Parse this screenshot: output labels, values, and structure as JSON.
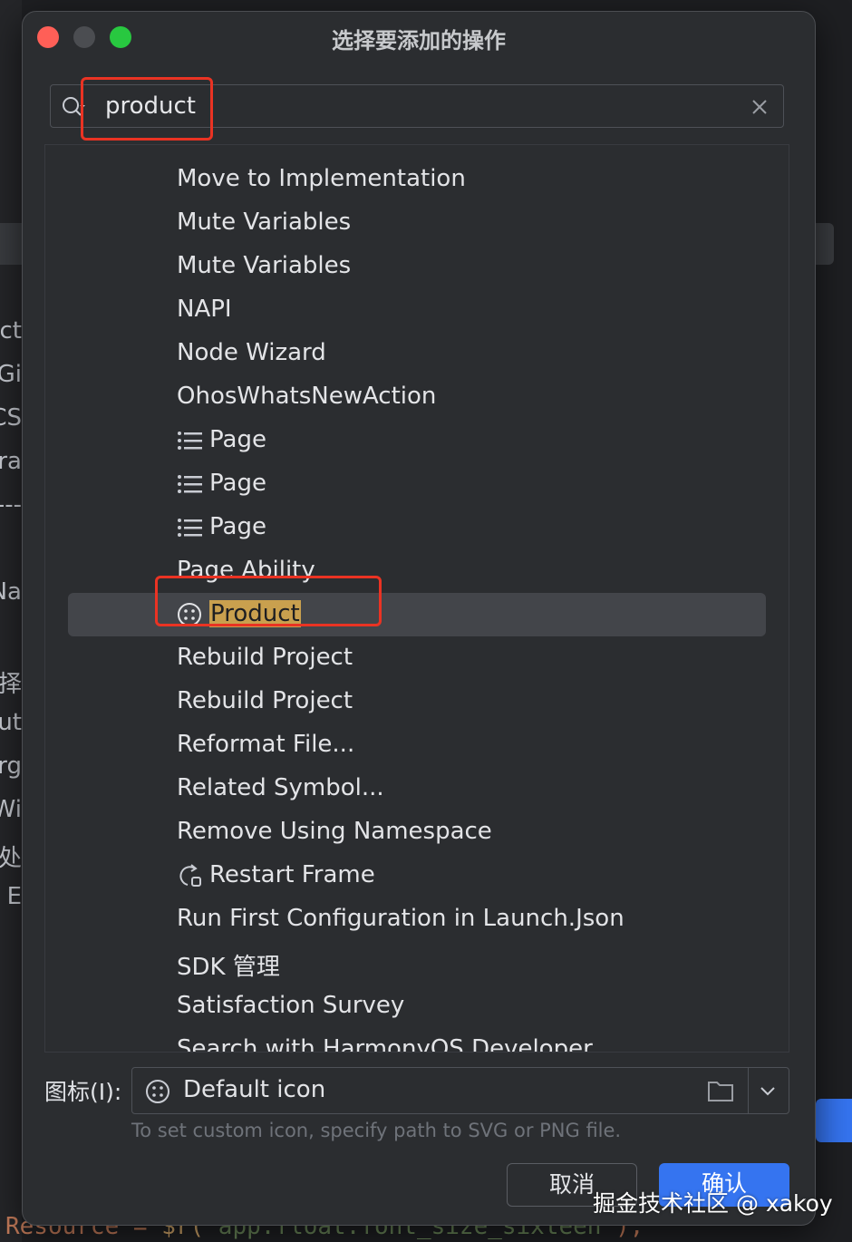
{
  "background": {
    "fragments": [
      "ect",
      "Gi",
      "CS",
      "era",
      "---",
      "Na",
      "择",
      "ut",
      "arg",
      "Wi",
      "处",
      "E"
    ],
    "code_prefix": "Resource = ",
    "code_fn": "$r(",
    "code_string": "'app.float.font_size_sixteen'",
    "code_suffix": ");"
  },
  "dialog": {
    "title": "选择要添加的操作",
    "search": {
      "value": "product"
    },
    "items": [
      {
        "label": "Move to Implementation",
        "icon": ""
      },
      {
        "label": "Mute Variables",
        "icon": ""
      },
      {
        "label": "Mute Variables",
        "icon": ""
      },
      {
        "label": "NAPI",
        "icon": ""
      },
      {
        "label": "Node Wizard",
        "icon": ""
      },
      {
        "label": "OhosWhatsNewAction",
        "icon": ""
      },
      {
        "label": "Page",
        "icon": "list-icon"
      },
      {
        "label": "Page",
        "icon": "list-icon"
      },
      {
        "label": "Page",
        "icon": "list-icon"
      },
      {
        "label": "Page Ability",
        "icon": ""
      },
      {
        "label": "Product",
        "icon": "face-icon",
        "selected": true
      },
      {
        "label": "Rebuild Project",
        "icon": ""
      },
      {
        "label": "Rebuild Project",
        "icon": ""
      },
      {
        "label": "Reformat File...",
        "icon": ""
      },
      {
        "label": "Related Symbol...",
        "icon": ""
      },
      {
        "label": "Remove Using Namespace",
        "icon": ""
      },
      {
        "label": "Restart Frame",
        "icon": "restart-frame-icon"
      },
      {
        "label": "Run First Configuration in Launch.Json",
        "icon": ""
      },
      {
        "label": "SDK 管理",
        "icon": ""
      },
      {
        "label": "Satisfaction Survey",
        "icon": ""
      },
      {
        "label": "Search with HarmonyOS Developer",
        "icon": ""
      }
    ],
    "icon_field": {
      "label": "图标(I):",
      "value": "Default icon",
      "hint": "To set custom icon, specify path to SVG or PNG file."
    },
    "buttons": {
      "cancel": "取消",
      "ok": "确认"
    },
    "colors": {
      "accent": "#3574f0",
      "highlight_box": "#ea3323",
      "match": "#c9a04e",
      "selection": "#43454a"
    }
  },
  "watermark": "掘金技术社区 @ xakoy"
}
